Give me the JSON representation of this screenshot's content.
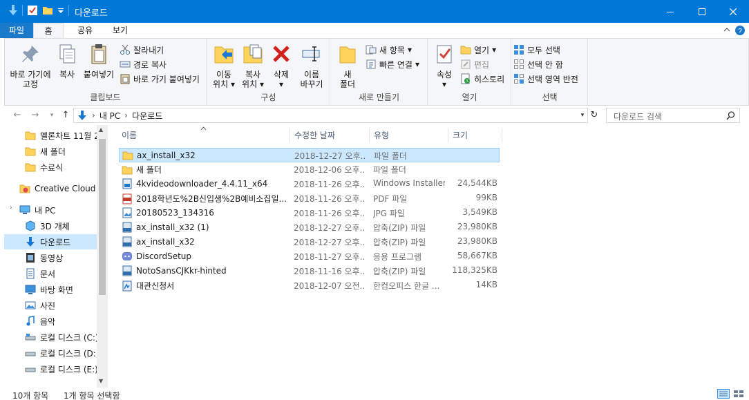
{
  "window": {
    "title": "다운로드"
  },
  "ribbon_tabs": {
    "file": "파일",
    "home": "홈",
    "share": "공유",
    "view": "보기"
  },
  "ribbon": {
    "clipboard": {
      "label": "클립보드",
      "pin_line1": "바로 가기에",
      "pin_line2": "고정",
      "copy": "복사",
      "paste": "붙여넣기",
      "cut": "잘라내기",
      "copy_path": "경로 복사",
      "paste_shortcut": "바로 가기 붙여넣기"
    },
    "organize": {
      "label": "구성",
      "move_line1": "이동",
      "move_line2": "위치",
      "copy_line1": "복사",
      "copy_line2": "위치",
      "delete": "삭제",
      "rename_line1": "이름",
      "rename_line2": "바꾸기"
    },
    "new": {
      "label": "새로 만들기",
      "folder_line1": "새",
      "folder_line2": "폴더",
      "new_item": "새 항목",
      "easy_access": "빠른 연결"
    },
    "open": {
      "label": "열기",
      "properties": "속성",
      "open": "열기",
      "edit": "편집",
      "history": "히스토리"
    },
    "select": {
      "label": "선택",
      "select_all": "모두 선택",
      "select_none": "선택 안 함",
      "invert": "선택 영역 반전"
    }
  },
  "address": {
    "path": [
      "내 PC",
      "다운로드"
    ],
    "search_placeholder": "다운로드 검색"
  },
  "navigation": {
    "items": [
      {
        "label": "멜론차트 11월 2",
        "icon": "folder-icon"
      },
      {
        "label": "새 폴더",
        "icon": "folder-icon"
      },
      {
        "label": "수료식",
        "icon": "folder-icon"
      },
      {
        "label": "Creative Cloud Fil",
        "icon": "creative-cloud-icon"
      },
      {
        "label": "내 PC",
        "icon": "pc-icon"
      },
      {
        "label": "3D 개체",
        "icon": "3d-objects-icon"
      },
      {
        "label": "다운로드",
        "icon": "download-icon"
      },
      {
        "label": "동영상",
        "icon": "video-icon"
      },
      {
        "label": "문서",
        "icon": "document-icon"
      },
      {
        "label": "바탕 화면",
        "icon": "desktop-icon"
      },
      {
        "label": "사진",
        "icon": "pictures-icon"
      },
      {
        "label": "음악",
        "icon": "music-icon"
      },
      {
        "label": "로컬 디스크 (C:)",
        "icon": "drive-icon"
      },
      {
        "label": "로컬 디스크 (D:)",
        "icon": "drive-icon"
      },
      {
        "label": "로컬 디스크 (E:)",
        "icon": "drive-icon"
      }
    ]
  },
  "columns": {
    "name": "이름",
    "date": "수정한 날짜",
    "type": "유형",
    "size": "크기"
  },
  "files": [
    {
      "name": "ax_install_x32",
      "date": "2018-12-27 오후...",
      "type": "파일 폴더",
      "size": "",
      "icon": "folder-icon"
    },
    {
      "name": "새 폴더",
      "date": "2018-12-06 오후...",
      "type": "파일 폴더",
      "size": "",
      "icon": "folder-icon"
    },
    {
      "name": "4kvideodownloader_4.4.11_x64",
      "date": "2018-11-26 오후...",
      "type": "Windows Installer...",
      "size": "24,544KB",
      "icon": "installer-icon"
    },
    {
      "name": "2018학년도%2B신입생%2B예비소집일...",
      "date": "2018-11-26 오후...",
      "type": "PDF 파일",
      "size": "99KB",
      "icon": "pdf-icon"
    },
    {
      "name": "20180523_134316",
      "date": "2018-11-26 오후...",
      "type": "JPG 파일",
      "size": "3,549KB",
      "icon": "image-icon"
    },
    {
      "name": "ax_install_x32 (1)",
      "date": "2018-12-27 오후...",
      "type": "압축(ZIP) 파일",
      "size": "23,980KB",
      "icon": "zip-icon"
    },
    {
      "name": "ax_install_x32",
      "date": "2018-12-27 오후...",
      "type": "압축(ZIP) 파일",
      "size": "23,980KB",
      "icon": "zip-icon"
    },
    {
      "name": "DiscordSetup",
      "date": "2018-11-27 오후...",
      "type": "응용 프로그램",
      "size": "58,667KB",
      "icon": "discord-icon"
    },
    {
      "name": "NotoSansCJKkr-hinted",
      "date": "2018-11-16 오후...",
      "type": "압축(ZIP) 파일",
      "size": "118,325KB",
      "icon": "zip-icon"
    },
    {
      "name": "대관신청서",
      "date": "2018-12-07 오전...",
      "type": "한컴오피스 한글 ...",
      "size": "14KB",
      "icon": "hwp-icon"
    }
  ],
  "status": {
    "count": "10개 항목",
    "selected": "1개 항목 선택함"
  }
}
